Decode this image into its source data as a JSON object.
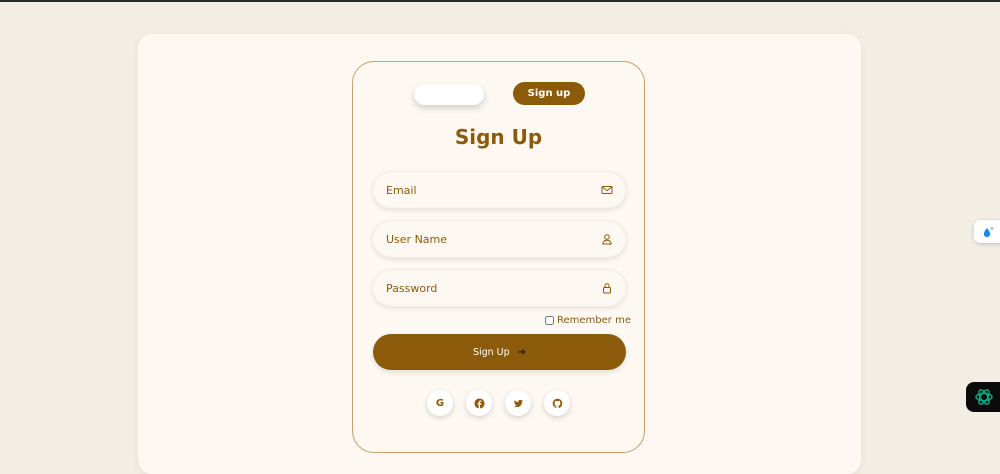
{
  "tabs": {
    "login_label": "",
    "signup_label": "Sign up"
  },
  "form": {
    "title": "Sign Up",
    "email": {
      "placeholder": "Email",
      "value": "",
      "icon": "mail-icon"
    },
    "username": {
      "placeholder": "User Name",
      "value": "",
      "icon": "user-icon"
    },
    "password": {
      "placeholder": "Password",
      "value": "",
      "icon": "lock-icon"
    },
    "remember_label": "Remember me",
    "remember_checked": false,
    "submit_label": "Sign Up",
    "submit_icon": "arrow-right-icon"
  },
  "social": [
    {
      "name": "google",
      "glyph": "G",
      "icon": "google-icon"
    },
    {
      "name": "facebook",
      "icon": "facebook-icon"
    },
    {
      "name": "twitter",
      "icon": "twitter-icon"
    },
    {
      "name": "github",
      "icon": "github-icon"
    }
  ],
  "extensions": [
    {
      "icon": "water-drop-icon"
    },
    {
      "icon": "openai-icon"
    }
  ],
  "colors": {
    "accent": "#8b5a0b",
    "background": "#f2eee4",
    "panel": "#fdf9f2",
    "card_border": "#c8a06e",
    "openai_green": "#10a37f"
  }
}
